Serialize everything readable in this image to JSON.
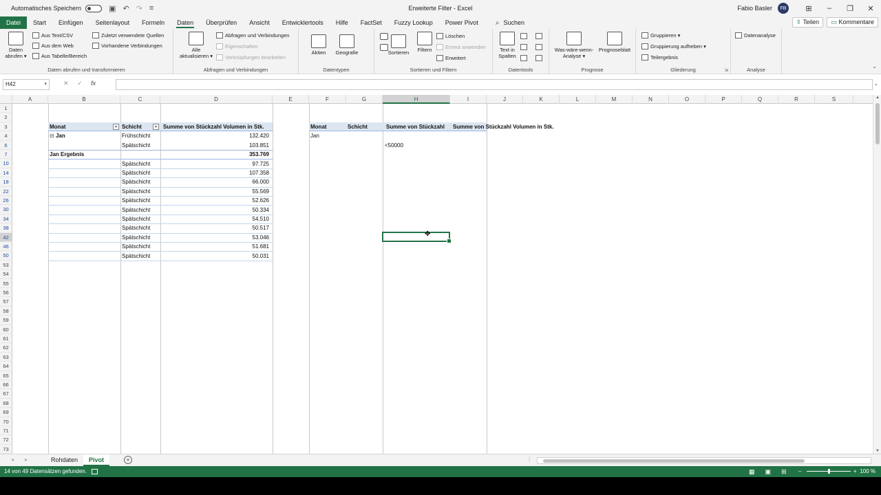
{
  "titlebar": {
    "autosave_label": "Automatisches Speichern",
    "title": "Erweiterte Filter - Excel",
    "user": "Fabio Basler",
    "initials": "FB"
  },
  "menu": {
    "file": "Datei",
    "tabs": [
      "Start",
      "Einfügen",
      "Seitenlayout",
      "Formeln",
      "Daten",
      "Überprüfen",
      "Ansicht",
      "Entwicklertools",
      "Hilfe",
      "FactSet",
      "Fuzzy Lookup",
      "Power Pivot"
    ],
    "active_tab": "Daten",
    "search": "Suchen",
    "share": "Teilen",
    "comments": "Kommentare"
  },
  "ribbon": {
    "g1": {
      "big": "Daten abrufen",
      "b1": "Aus Text/CSV",
      "b2": "Aus dem Web",
      "b3": "Aus Tabelle/Bereich",
      "b4": "Zuletzt verwendete Quellen",
      "b5": "Vorhandene Verbindungen",
      "label": "Daten abrufen und transformieren"
    },
    "g2": {
      "big": "Alle aktualisieren",
      "b1": "Abfragen und Verbindungen",
      "b2": "Eigenschaften",
      "b3": "Verknüpfungen bearbeiten",
      "label": "Abfragen und Verbindungen"
    },
    "g3": {
      "b1": "Aktien",
      "b2": "Geografie",
      "label": "Datentypen"
    },
    "g4": {
      "b1": "Sortieren",
      "b2": "Filtern",
      "b3": "Löschen",
      "b4": "Erneut anwenden",
      "b5": "Erweitert",
      "label": "Sortieren und Filtern"
    },
    "g5": {
      "b1": "Text in Spalten",
      "label": "Datentools"
    },
    "g6": {
      "b1": "Was-wäre-wenn-Analyse",
      "b2": "Prognoseblatt",
      "label": "Prognose"
    },
    "g7": {
      "b1": "Gruppieren",
      "b2": "Gruppierung aufheben",
      "b3": "Teilergebnis",
      "label": "Gliederung"
    },
    "g8": {
      "b1": "Datenanalyse",
      "label": "Analyse"
    }
  },
  "formula_bar": {
    "name_box": "H42",
    "formula": ""
  },
  "columns": [
    "A",
    "B",
    "C",
    "D",
    "E",
    "F",
    "G",
    "H",
    "I",
    "J",
    "K",
    "L",
    "M",
    "N",
    "O",
    "P",
    "Q",
    "R",
    "S"
  ],
  "rows": [
    "1",
    "2",
    "3",
    "4",
    "6",
    "7",
    "10",
    "14",
    "18",
    "22",
    "26",
    "30",
    "34",
    "38",
    "42",
    "46",
    "50",
    "53",
    "54",
    "55",
    "56",
    "57",
    "58",
    "59",
    "60",
    "61",
    "62",
    "63",
    "64",
    "65",
    "66",
    "67",
    "68",
    "69",
    "70",
    "71",
    "72",
    "73"
  ],
  "pivot": {
    "headers": {
      "month": "Monat",
      "shift": "Schicht",
      "sum": "Summe von Stückzahl Volumen in Stk."
    },
    "row4": {
      "month": "Jan",
      "shift": "Frühschicht",
      "value": "132.420"
    },
    "row6": {
      "shift": "Spätschicht",
      "value": "103.851"
    },
    "row7": {
      "month": "Jan Ergebnis",
      "value": "353.769"
    },
    "rows": [
      {
        "shift": "Spätschicht",
        "value": "97.725"
      },
      {
        "shift": "Spätschicht",
        "value": "107.358"
      },
      {
        "shift": "Spätschicht",
        "value": "66.000"
      },
      {
        "shift": "Spätschicht",
        "value": "55.569"
      },
      {
        "shift": "Spätschicht",
        "value": "52.626"
      },
      {
        "shift": "Spätschicht",
        "value": "50.334"
      },
      {
        "shift": "Spätschicht",
        "value": "54.510"
      },
      {
        "shift": "Spätschicht",
        "value": "50.517"
      },
      {
        "shift": "Spätschicht",
        "value": "53.046"
      },
      {
        "shift": "Spätschicht",
        "value": "51.681"
      },
      {
        "shift": "Spätschicht",
        "value": "50.031"
      }
    ]
  },
  "criteria": {
    "headers": {
      "month": "Monat",
      "shift": "Schicht",
      "sum1": "Summe von Stückzahl",
      "sum2": "Summe von Stückzahl Volumen in Stk."
    },
    "month": "Jan",
    "condition": "<50000"
  },
  "sheets": {
    "tabs": [
      "Rohdaten",
      "Pivot"
    ],
    "active": "Pivot"
  },
  "status": {
    "message": "14 von 49 Datensätzen gefunden.",
    "zoom": "100 %"
  },
  "colors": {
    "accent": "#217346",
    "header_fill": "#dce6f1"
  }
}
